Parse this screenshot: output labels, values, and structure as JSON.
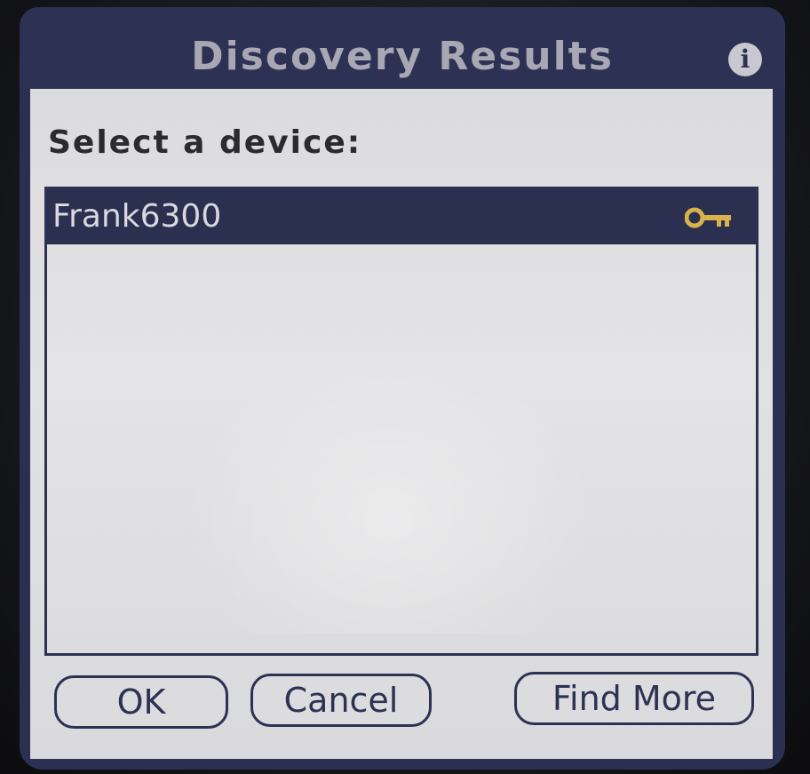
{
  "window": {
    "title": "Discovery Results",
    "info_icon": "info-icon"
  },
  "form": {
    "prompt": "Select a device:"
  },
  "device_list": {
    "items": [
      {
        "label": "Frank6300",
        "selected": true,
        "icon": "key-icon"
      }
    ]
  },
  "buttons": {
    "ok_label": "OK",
    "cancel_label": "Cancel",
    "find_more_label": "Find More"
  },
  "colors": {
    "title_bar": "#2d3153",
    "title_text": "#a9a7b4",
    "selection": "#2b2f50",
    "key_icon": "#d9b34a",
    "background": "#dcdcde"
  }
}
